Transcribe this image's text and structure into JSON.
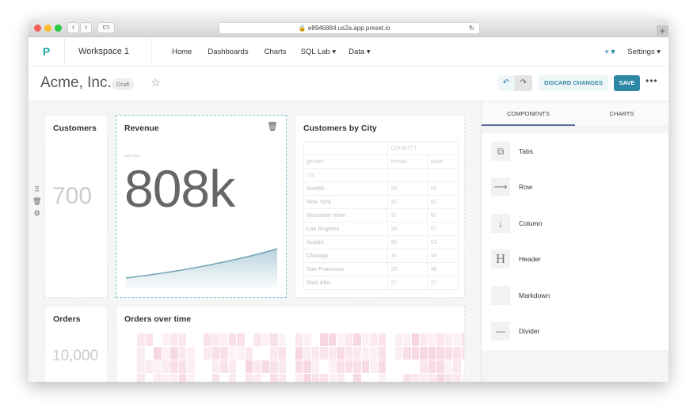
{
  "browser": {
    "url": "e8946884.us2a.app.preset.io"
  },
  "nav": {
    "logo": "P",
    "workspace": "Workspace 1",
    "items": [
      "Home",
      "Dashboards",
      "Charts",
      "SQL Lab ▾",
      "Data ▾"
    ],
    "add": "+ ▾",
    "settings": "Settings ▾"
  },
  "header": {
    "title": "Acme, Inc.",
    "badge": "Draft",
    "discard": "DISCARD CHANGES",
    "save": "SAVE"
  },
  "cards": {
    "customers": {
      "title": "Customers",
      "value": "700"
    },
    "revenue": {
      "title": "Revenue",
      "date": "Nov 2021",
      "value": "808k"
    },
    "city": {
      "title": "Customers by City",
      "metric": "COUNT(*)",
      "gender": "gender",
      "female": "female",
      "male": "male",
      "city": "city",
      "rows": [
        [
          "Seattle",
          "33",
          "66"
        ],
        [
          "New York",
          "30",
          "62"
        ],
        [
          "Mountain View",
          "32",
          "60"
        ],
        [
          "Los Angeles",
          "39",
          "57"
        ],
        [
          "Austin",
          "35",
          "53"
        ],
        [
          "Chicago",
          "34",
          "48"
        ],
        [
          "San Francisco",
          "29",
          "48"
        ],
        [
          "Palo Alto",
          "27",
          "47"
        ]
      ]
    },
    "orders": {
      "title": "Orders",
      "value": "10,000"
    },
    "orders_time": {
      "title": "Orders over time"
    }
  },
  "sidebar": {
    "tabs": [
      "COMPONENTS",
      "CHARTS"
    ],
    "items": [
      {
        "label": "Tabs",
        "icon": "tabs-icon"
      },
      {
        "label": "Row",
        "icon": "arrow-right-icon"
      },
      {
        "label": "Column",
        "icon": "arrow-down-icon"
      },
      {
        "label": "Header",
        "icon": "header-icon"
      },
      {
        "label": "Markdown",
        "icon": "code-icon"
      },
      {
        "label": "Divider",
        "icon": "divider-icon"
      }
    ]
  },
  "colors": {
    "accent": "#2e88a5",
    "logo": "#20a7a0",
    "heat": "#e8a0b0"
  }
}
